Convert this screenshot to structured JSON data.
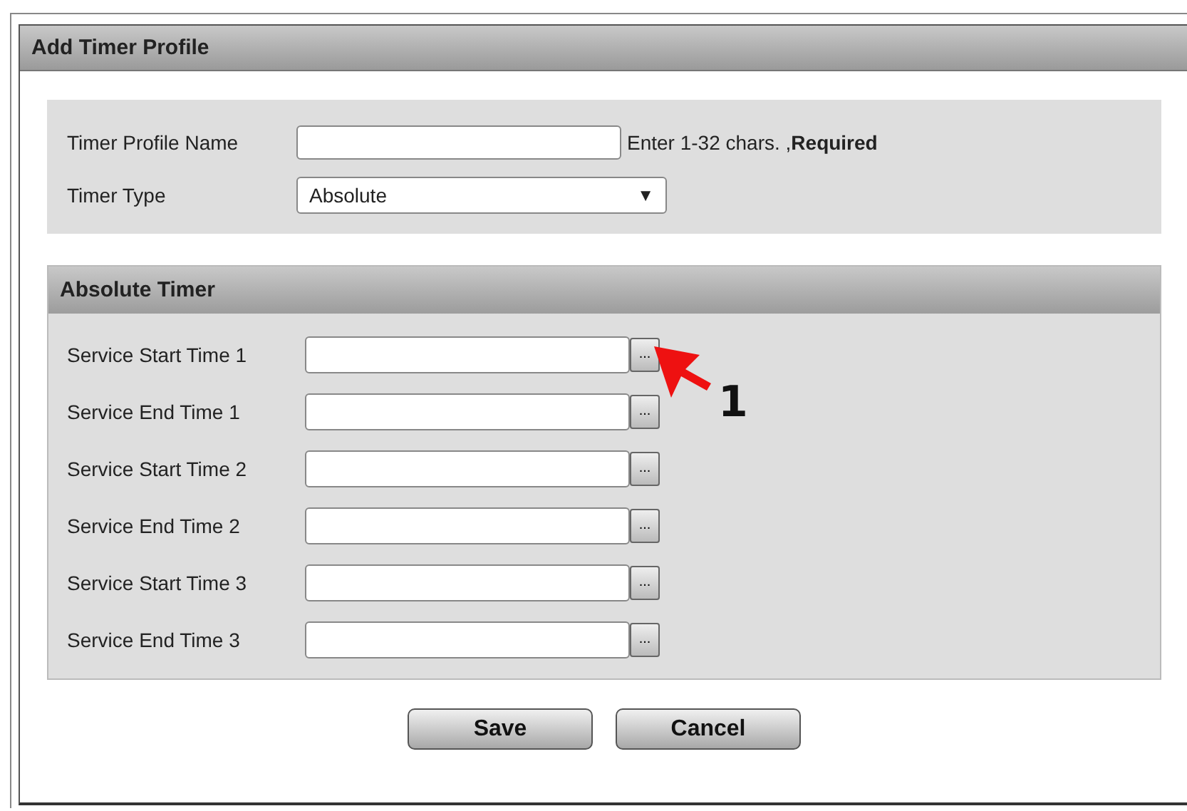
{
  "dialog": {
    "title": "Add Timer Profile"
  },
  "profile": {
    "name_label": "Timer Profile Name",
    "name_hint": "Enter 1-32 chars. ,**Required**",
    "type_label": "Timer Type",
    "type_value": "Absolute",
    "type_caret": "▼"
  },
  "section": {
    "title": "Absolute Timer",
    "rows": [
      {
        "label": "Service Start Time 1",
        "picker": "..."
      },
      {
        "label": "Service End Time 1",
        "picker": "..."
      },
      {
        "label": "Service Start Time 2",
        "picker": "..."
      },
      {
        "label": "Service End Time 2",
        "picker": "..."
      },
      {
        "label": "Service Start Time 3",
        "picker": "..."
      },
      {
        "label": "Service End Time 3",
        "picker": "..."
      }
    ]
  },
  "callout": {
    "label": "1"
  },
  "buttons": [
    "Save",
    "Cancel"
  ]
}
